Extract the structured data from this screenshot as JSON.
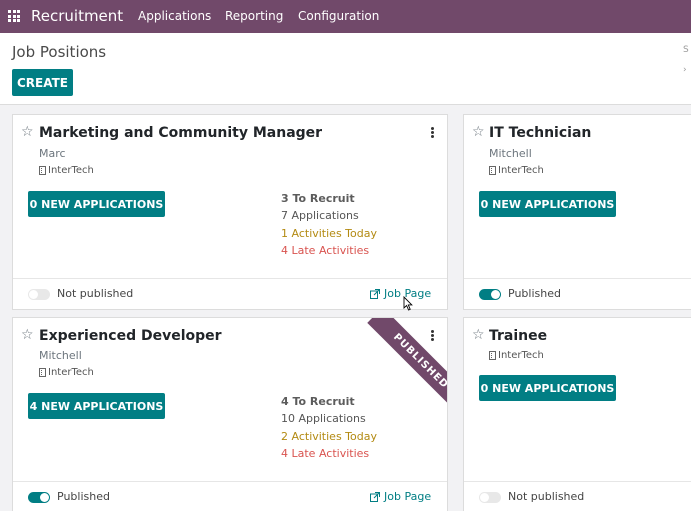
{
  "navbar": {
    "app_name": "Recruitment",
    "menu": [
      "Applications",
      "Reporting",
      "Configuration"
    ]
  },
  "control_panel": {
    "title": "Job Positions",
    "create_label": "CREATE",
    "search_fragment": "S"
  },
  "cards": [
    {
      "title": "Marketing and Community Manager",
      "recruiter": "Marc",
      "company": "InterTech",
      "new_apps": "0 NEW APPLICATIONS",
      "to_recruit": "3 To Recruit",
      "applications": "7 Applications",
      "activities_today": "1 Activities Today",
      "late_activities": "4 Late Activities",
      "published_label": "Not published",
      "published": false,
      "job_page": "Job Page"
    },
    {
      "title": "IT Technician",
      "recruiter": "Mitchell",
      "company": "InterTech",
      "new_apps": "0 NEW APPLICATIONS",
      "published_label": "Published",
      "published": true
    },
    {
      "title": "Experienced Developer",
      "recruiter": "Mitchell",
      "company": "InterTech",
      "new_apps": "4 NEW APPLICATIONS",
      "to_recruit": "4 To Recruit",
      "applications": "10 Applications",
      "activities_today": "2 Activities Today",
      "late_activities": "4 Late Activities",
      "published_label": "Published",
      "published": true,
      "job_page": "Job Page",
      "ribbon": "PUBLISHED"
    },
    {
      "title": "Trainee",
      "company": "InterTech",
      "new_apps": "0 NEW APPLICATIONS",
      "published_label": "Not published",
      "published": false
    }
  ],
  "colors": {
    "navbar": "#71496a",
    "primary": "#017e84",
    "activities_today": "#b38a12",
    "late_activities": "#d9534f"
  }
}
